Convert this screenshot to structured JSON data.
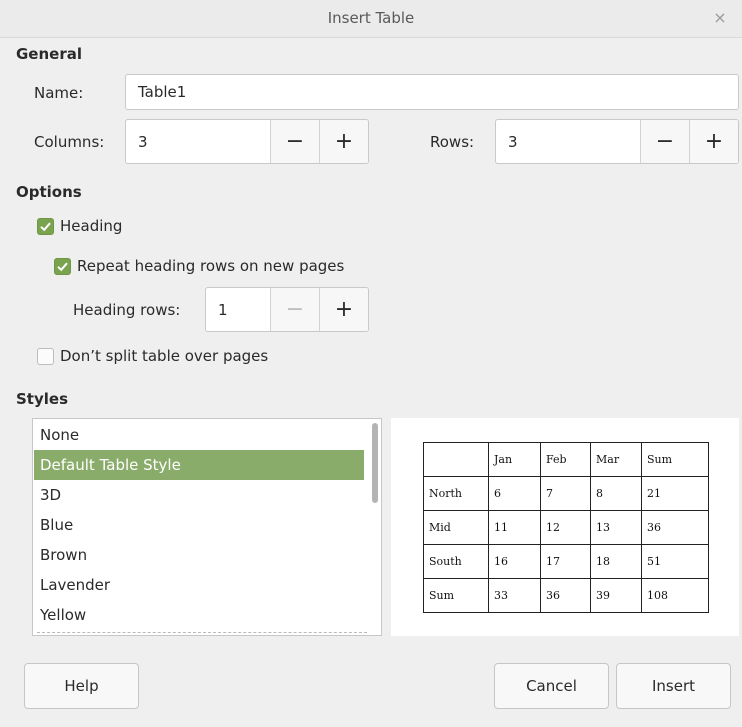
{
  "window": {
    "title": "Insert Table",
    "close_glyph": "×"
  },
  "general": {
    "heading": "General",
    "name_label": "Name:",
    "name_value": "Table1",
    "columns_label": "Columns:",
    "columns_value": "3",
    "rows_label": "Rows:",
    "rows_value": "3",
    "minus": "−",
    "plus": "+"
  },
  "options": {
    "heading": "Options",
    "heading_check": {
      "label": "Heading",
      "checked": true
    },
    "repeat_check": {
      "label": "Repeat heading rows on new pages",
      "checked": true
    },
    "heading_rows_label": "Heading rows:",
    "heading_rows_value": "1",
    "split_check": {
      "label": "Don’t split table over pages",
      "checked": false
    }
  },
  "styles": {
    "heading": "Styles",
    "items": [
      "None",
      "Default Table Style",
      "3D",
      "Blue",
      "Brown",
      "Lavender",
      "Yellow"
    ],
    "selected": "Default Table Style",
    "selection_color": "#8aac6b"
  },
  "preview_table": {
    "rows": [
      [
        "",
        "Jan",
        "Feb",
        "Mar",
        "Sum"
      ],
      [
        "North",
        "6",
        "7",
        "8",
        "21"
      ],
      [
        "Mid",
        "11",
        "12",
        "13",
        "36"
      ],
      [
        "South",
        "16",
        "17",
        "18",
        "51"
      ],
      [
        "Sum",
        "33",
        "36",
        "39",
        "108"
      ]
    ]
  },
  "buttons": {
    "help": "Help",
    "cancel": "Cancel",
    "insert": "Insert"
  },
  "colors": {
    "check_accent": "#7aa34f"
  }
}
